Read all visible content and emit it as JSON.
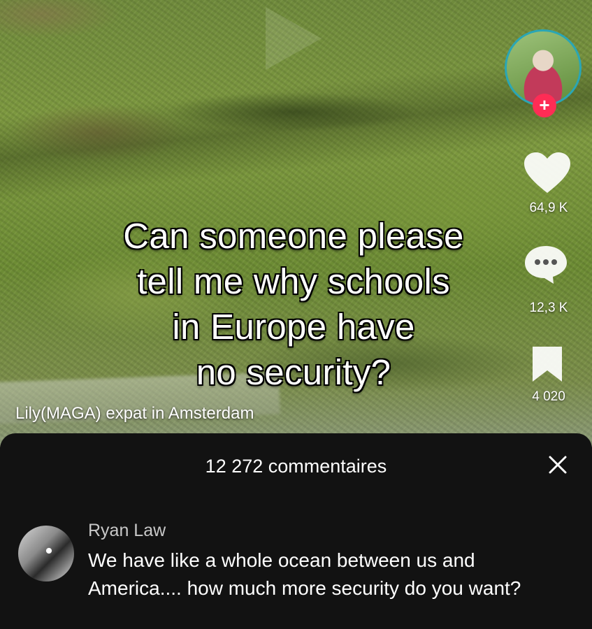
{
  "video": {
    "caption_lines": [
      "Can someone please",
      "tell me why schools",
      "in Europe have",
      "no security?"
    ],
    "author": "Lily(MAGA) expat in Amsterdam"
  },
  "actions": {
    "likes": "64,9 K",
    "comments": "12,3 K",
    "saves": "4 020",
    "follow_symbol": "+"
  },
  "comments_sheet": {
    "title": "12 272 commentaires",
    "close_symbol": "×",
    "comments": [
      {
        "author": "Ryan Law",
        "text": "We have like a whole ocean between us and America.... how much more security do you want?"
      }
    ]
  },
  "colors": {
    "follow_button": "#fe2c55",
    "avatar_ring": "#2aa6b5",
    "sheet_background": "#121212"
  },
  "icons": [
    "heart-icon",
    "comment-bubble-icon",
    "bookmark-icon",
    "close-icon",
    "plus-icon"
  ]
}
